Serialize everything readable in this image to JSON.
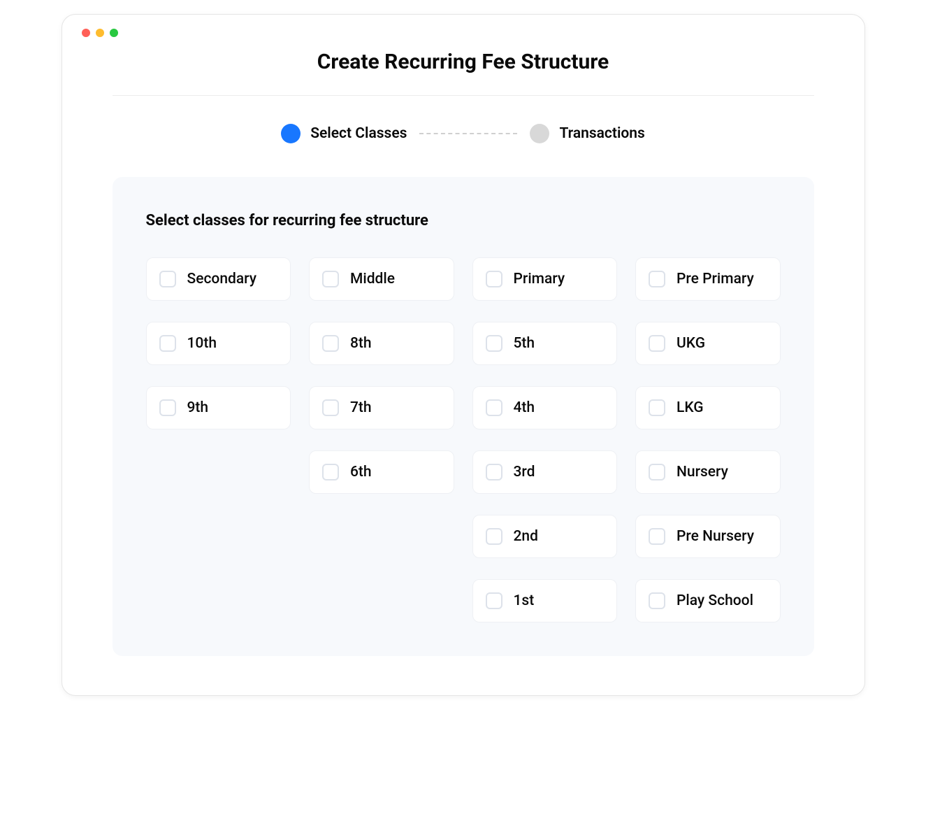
{
  "header": {
    "title": "Create Recurring Fee Structure"
  },
  "stepper": {
    "steps": [
      {
        "label": "Select Classes",
        "active": true
      },
      {
        "label": "Transactions",
        "active": false
      }
    ]
  },
  "panel": {
    "heading": "Select classes for recurring fee structure",
    "columns": [
      [
        "Secondary",
        "10th",
        "9th"
      ],
      [
        "Middle",
        "8th",
        "7th",
        "6th"
      ],
      [
        "Primary",
        "5th",
        "4th",
        "3rd",
        "2nd",
        "1st"
      ],
      [
        "Pre Primary",
        "UKG",
        "LKG",
        "Nursery",
        "Pre Nursery",
        "Play School"
      ]
    ]
  }
}
